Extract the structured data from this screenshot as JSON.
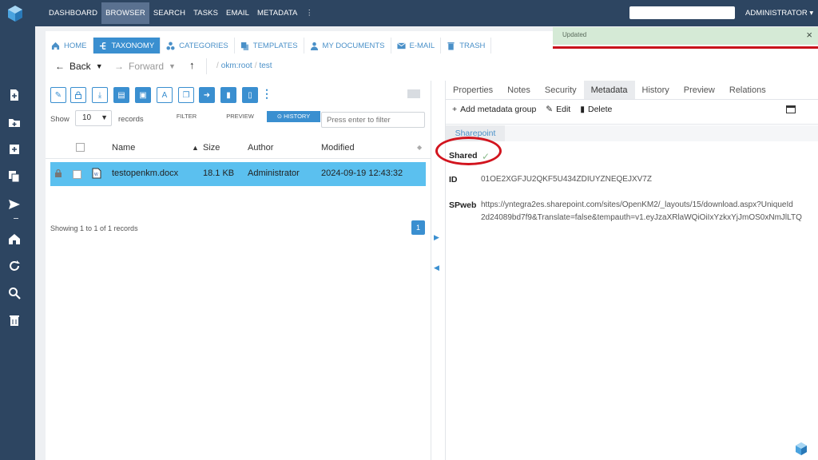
{
  "topnav": {
    "items": [
      "DASHBOARD",
      "BROWSER",
      "SEARCH",
      "TASKS",
      "EMAIL",
      "METADATA"
    ],
    "more_icon": "vertical-dots-icon",
    "user": "ADMINISTRATOR"
  },
  "tabs": [
    "HOME",
    "TAXONOMY",
    "CATEGORIES",
    "TEMPLATES",
    "MY DOCUMENTS",
    "E-MAIL",
    "TRASH"
  ],
  "notification": {
    "text": "Updated",
    "close": "×"
  },
  "nav": {
    "back": "Back",
    "forward": "Forward",
    "path": [
      "/",
      "okm:root",
      "/",
      "test"
    ]
  },
  "list": {
    "show_label": "Show",
    "records_per_page": "10",
    "records_label": "records",
    "subtabs": [
      "FILTER",
      "PREVIEW",
      "HISTORY"
    ],
    "filter_placeholder": "Press enter to filter",
    "columns": [
      "Name",
      "Size",
      "Author",
      "Modified"
    ],
    "rows": [
      {
        "name": "testopenkm.docx",
        "size": "18.1 KB",
        "author": "Administrator",
        "modified": "2024-09-19 12:43:32"
      }
    ],
    "summary": "Showing 1 to 1 of 1 records",
    "page": "1"
  },
  "properties": {
    "tabs": [
      "Properties",
      "Notes",
      "Security",
      "Metadata",
      "History",
      "Preview",
      "Relations"
    ],
    "active_tab": "Metadata",
    "actions": {
      "add_group": "Add metadata group",
      "edit": "Edit",
      "delete": "Delete"
    },
    "group_tab": "Sharepoint",
    "fields": {
      "shared_label": "Shared",
      "id_label": "ID",
      "id_value": "01OE2XGFJU2QKF5U434ZDIUYZNEQEJXV7Z",
      "spweb_label": "SPweb",
      "spweb_line1": "https://yntegra2es.sharepoint.com/sites/OpenKM2/_layouts/15/download.aspx?UniqueId",
      "spweb_line2": "2d24089bd7f9&Translate=false&tempauth=v1.eyJzaXRlaWQiOiIxYzkxYjJmOS0xNmJlLTQ"
    }
  },
  "colors": {
    "nav_bg": "#2d4561",
    "accent": "#3a8fd0",
    "row_highlight": "#5bc0ef",
    "notification_bg": "#d5ead6",
    "annotation_red": "#d2141e"
  }
}
